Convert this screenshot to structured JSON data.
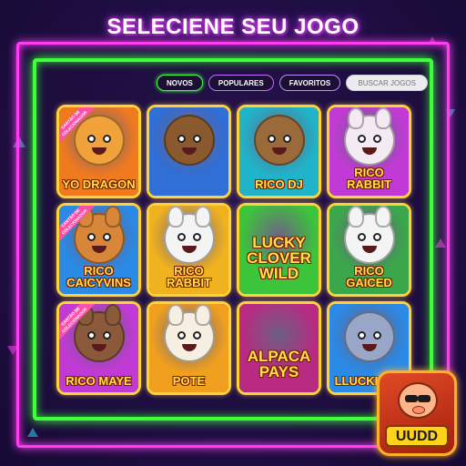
{
  "page": {
    "title": "SELECIENE SEU JOGO"
  },
  "tabs": [
    {
      "label": "NOVOS",
      "active": true
    },
    {
      "label": "POPULARES",
      "active": false
    },
    {
      "label": "FAVORITOS",
      "active": false
    }
  ],
  "search": {
    "placeholder": "BUSCAR JOGOS"
  },
  "games": [
    {
      "title": "YO DRAGON",
      "ribbon": "CARTÃO DE COLECIONADOR",
      "colors": {
        "bg": "#f07a1e",
        "char": "#f2a23a"
      }
    },
    {
      "title": "",
      "colors": {
        "bg": "#2f6fd6",
        "char": "#8a5a2e"
      }
    },
    {
      "title": "RICO DJ",
      "colors": {
        "bg": "#1fb4c9",
        "char": "#9a6a3a"
      }
    },
    {
      "title": "RICO RABBIT",
      "colors": {
        "bg": "#c23ad6",
        "char": "#f4eaf4"
      }
    },
    {
      "title": "RICO CAICYVINS",
      "ribbon": "CARTÃO DE COLECIONADOR",
      "colors": {
        "bg": "#2a8ae6",
        "char": "#d8873a"
      }
    },
    {
      "title": "RICO RABBIT",
      "colors": {
        "bg": "#f0b21e",
        "char": "#f4f4f4"
      }
    },
    {
      "title": "LUCKY CLOVER WILD",
      "colors": {
        "bg": "#3cc43a",
        "char": "#3cc43a"
      }
    },
    {
      "title": "RICO GAICED",
      "colors": {
        "bg": "#3aa84a",
        "char": "#f4f4f4"
      }
    },
    {
      "title": "RICO MAYE",
      "ribbon": "CARTÃO DE COLECIONADOR",
      "colors": {
        "bg": "#c23ad6",
        "char": "#8a5a3a"
      }
    },
    {
      "title": "POTE",
      "colors": {
        "bg": "#f0a01e",
        "char": "#f6efe2"
      }
    },
    {
      "title": "ALPACA PAYS",
      "colors": {
        "bg": "#b92a82",
        "char": "#f0c030"
      }
    },
    {
      "title": "LLUCKI PAY",
      "colors": {
        "bg": "#2a8ae6",
        "char": "#9aa6c8"
      }
    }
  ],
  "app_badge": {
    "label": "UUDD"
  }
}
